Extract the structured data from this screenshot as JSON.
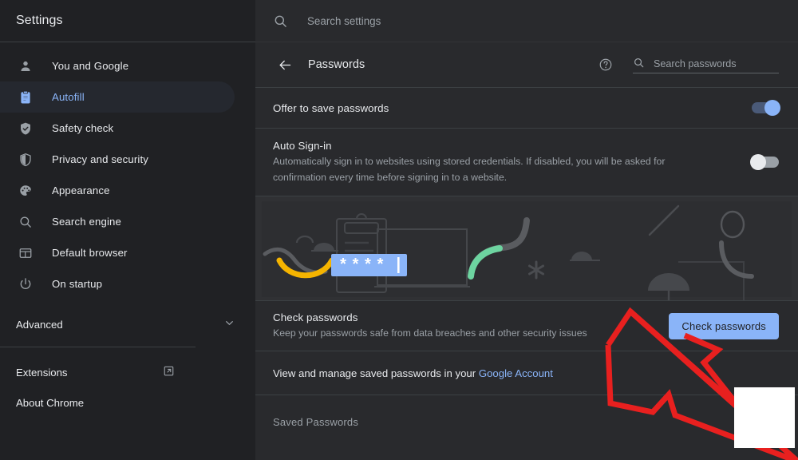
{
  "sidebar": {
    "title": "Settings",
    "items": [
      {
        "label": "You and Google",
        "icon": "person-icon",
        "active": false
      },
      {
        "label": "Autofill",
        "icon": "clipboard-icon",
        "active": true
      },
      {
        "label": "Safety check",
        "icon": "shield-check-icon",
        "active": false
      },
      {
        "label": "Privacy and security",
        "icon": "shield-icon",
        "active": false
      },
      {
        "label": "Appearance",
        "icon": "palette-icon",
        "active": false
      },
      {
        "label": "Search engine",
        "icon": "search-icon",
        "active": false
      },
      {
        "label": "Default browser",
        "icon": "browser-window-icon",
        "active": false
      },
      {
        "label": "On startup",
        "icon": "power-icon",
        "active": false
      }
    ],
    "advanced": {
      "label": "Advanced",
      "icon": "chevron-down-icon"
    },
    "bottom_items": [
      {
        "label": "Extensions",
        "icon": "external-link-icon"
      },
      {
        "label": "About Chrome",
        "icon": ""
      }
    ]
  },
  "topbar": {
    "search_placeholder": "Search settings",
    "search_value": "",
    "search_icon": "search-icon"
  },
  "page": {
    "title": "Passwords",
    "back_icon": "arrow-left-icon",
    "help_icon": "help-circle-icon",
    "password_search_placeholder": "Search passwords",
    "password_search_value": "",
    "password_search_icon": "search-icon"
  },
  "settings": {
    "offer_to_save": {
      "title": "Offer to save passwords",
      "toggle_state": "on"
    },
    "auto_signin": {
      "title": "Auto Sign-in",
      "description": "Automatically sign in to websites using stored credentials. If disabled, you will be asked for confirmation every time before signing in to a website.",
      "toggle_state": "off"
    }
  },
  "banner": {
    "illustration_name": "password-check-illustration",
    "password_field_text": "****",
    "accent_yellow": "#f5b400",
    "accent_green": "#6dd4a0",
    "accent_blue": "#8ab4f8"
  },
  "check_passwords": {
    "title": "Check passwords",
    "description": "Keep your passwords safe from data breaches and other security issues",
    "button_label": "Check passwords"
  },
  "manage": {
    "text_before": "View and manage saved passwords in your",
    "link_label": "Google Account"
  },
  "saved_passwords": {
    "heading": "Saved Passwords"
  },
  "annotation": {
    "arrow_color": "#e8201f",
    "arrow_name": "red-arrow-annotation",
    "redaction_name": "white-redaction-box",
    "redaction_color": "#ffffff"
  },
  "colors": {
    "sidebar_bg": "#202124",
    "main_bg": "#292a2d",
    "banner_bg": "#303134",
    "accent": "#8ab4f8",
    "text_primary": "#e8eaed",
    "text_secondary": "#9aa0a6",
    "divider": "#3c4043"
  }
}
